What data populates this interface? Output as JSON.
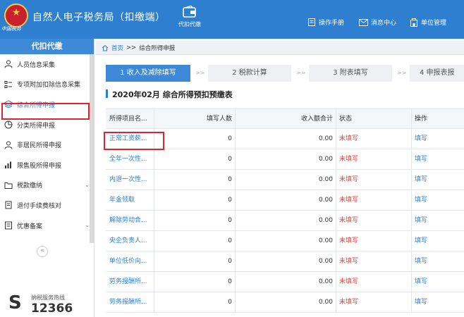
{
  "header": {
    "logo_text": "中国税务",
    "app_title": "自然人电子税务局（扣缴端）",
    "module_label": "代扣代缴",
    "links": [
      {
        "label": "操作手册",
        "icon": "book-icon"
      },
      {
        "label": "消息中心",
        "icon": "mail-icon"
      },
      {
        "label": "单位管理",
        "icon": "building-icon"
      }
    ]
  },
  "sidebar": {
    "title": "代扣代缴",
    "items": [
      {
        "label": "人员信息采集",
        "icon": "person-icon"
      },
      {
        "label": "专项附加扣除信息采集",
        "icon": "list-icon"
      },
      {
        "label": "综合所得申报",
        "icon": "layers-icon",
        "active": true
      },
      {
        "label": "分类所得申报",
        "icon": "pie-icon"
      },
      {
        "label": "非居民所得申报",
        "icon": "user-icon"
      },
      {
        "label": "限售股所得申报",
        "icon": "bar-chart-icon"
      },
      {
        "label": "税款缴纳",
        "icon": "folder-icon",
        "expandable": true
      },
      {
        "label": "退付手续费核对",
        "icon": "document-icon"
      },
      {
        "label": "优惠备案",
        "icon": "checklist-icon",
        "expandable": true
      }
    ],
    "collapse_glyph": "«",
    "hotline_label": "纳税服务热线",
    "hotline_number": "12366"
  },
  "breadcrumb": {
    "home": "首页",
    "separator": ">>",
    "current": "综合所得申报"
  },
  "steps": [
    {
      "label": "1 收入及减除填写",
      "active": true
    },
    {
      "label": "2 税款计算"
    },
    {
      "label": "3 附表填写"
    },
    {
      "label": "4 申报表报"
    }
  ],
  "step_separator": ">>",
  "form_title": "2020年02月  综合所得预扣预缴表",
  "table": {
    "columns": [
      "所得项目名...",
      "填写人数",
      "收入额合计",
      "状态",
      "操作"
    ],
    "rows": [
      {
        "name": "正常工资薪...",
        "count": "0",
        "amount": "0.00",
        "status": "未填写",
        "action": "填写"
      },
      {
        "name": "全年一次性...",
        "count": "0",
        "amount": "0.00",
        "status": "未填写",
        "action": "填写"
      },
      {
        "name": "内退一次性...",
        "count": "0",
        "amount": "0.00",
        "status": "未填写",
        "action": "填写"
      },
      {
        "name": "年金领取",
        "count": "0",
        "amount": "0.00",
        "status": "未填写",
        "action": "填写"
      },
      {
        "name": "解除劳动合...",
        "count": "0",
        "amount": "0.00",
        "status": "未填写",
        "action": "填写"
      },
      {
        "name": "央企负责人...",
        "count": "0",
        "amount": "0.00",
        "status": "未填写",
        "action": "填写"
      },
      {
        "name": "单位低价向...",
        "count": "0",
        "amount": "0.00",
        "status": "未填写",
        "action": "填写"
      },
      {
        "name": "劳务报酬所...",
        "count": "0",
        "amount": "0.00",
        "status": "未填写",
        "action": "填写"
      },
      {
        "name": "劳务报酬所...",
        "count": "0",
        "amount": "0.00",
        "status": "未填写",
        "action": "填写"
      }
    ]
  },
  "colors": {
    "header_bg": "#2e7fd0",
    "accent": "#3d89d8",
    "status_unfilled": "#e63d3d",
    "highlight": "#e0242f"
  }
}
